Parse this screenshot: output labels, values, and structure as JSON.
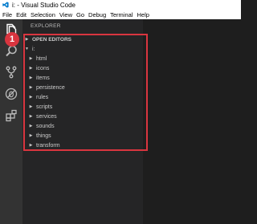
{
  "window": {
    "title": "i: - Visual Studio Code"
  },
  "menubar": {
    "items": [
      "File",
      "Edit",
      "Selection",
      "View",
      "Go",
      "Debug",
      "Terminal",
      "Help"
    ]
  },
  "activitybar": {
    "icons": [
      "explorer-icon",
      "search-icon",
      "source-control-icon",
      "debug-icon",
      "extensions-icon"
    ]
  },
  "sidebar": {
    "title": "EXPLORER",
    "open_editors_label": "OPEN EDITORS",
    "root_label": "i:",
    "folders": [
      "html",
      "icons",
      "items",
      "persistence",
      "rules",
      "scripts",
      "services",
      "sounds",
      "things",
      "transform"
    ]
  },
  "annotation": {
    "step_number": "1",
    "highlight_color": "#d9353f"
  },
  "colors": {
    "activitybar": "#333333",
    "sidebar": "#252526",
    "editor": "#1e1e1e",
    "accent": "#007acc"
  }
}
